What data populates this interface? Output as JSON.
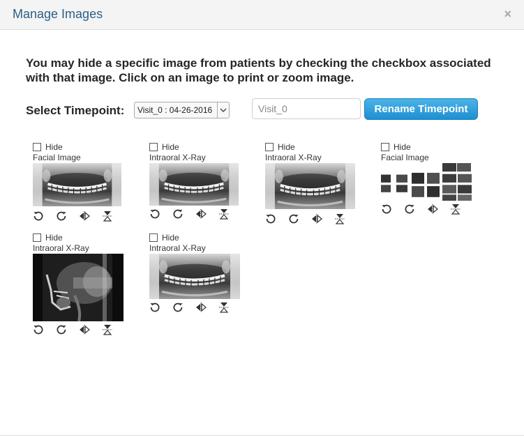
{
  "dialog": {
    "title": "Manage Images",
    "close_glyph": "×"
  },
  "instructions": "You may hide a specific image from patients by checking the checkbox associated with that image. Click on an image to print or zoom image.",
  "timepoint": {
    "label": "Select Timepoint:",
    "selected": "Visit_0 : 04-26-2016",
    "name_value": "Visit_0",
    "rename_label": "Rename Timepoint"
  },
  "cards": [
    {
      "hide_label": "Hide",
      "type": "Facial Image",
      "image_kind": "panoramic-xray",
      "checked": false
    },
    {
      "hide_label": "Hide",
      "type": "Intraoral X-Ray",
      "image_kind": "panoramic-xray",
      "checked": false
    },
    {
      "hide_label": "Hide",
      "type": "Intraoral X-Ray",
      "image_kind": "panoramic-xray",
      "checked": false
    },
    {
      "hide_label": "Hide",
      "type": "Facial Image",
      "image_kind": "photo-collage",
      "checked": false
    },
    {
      "hide_label": "Hide",
      "type": "Intraoral X-Ray",
      "image_kind": "cephalometric-xray",
      "checked": false
    },
    {
      "hide_label": "Hide",
      "type": "Intraoral X-Ray",
      "image_kind": "panoramic-xray",
      "checked": false
    }
  ],
  "controls": [
    "rotate-left-icon",
    "rotate-right-icon",
    "flip-horizontal-icon",
    "flip-vertical-icon"
  ]
}
